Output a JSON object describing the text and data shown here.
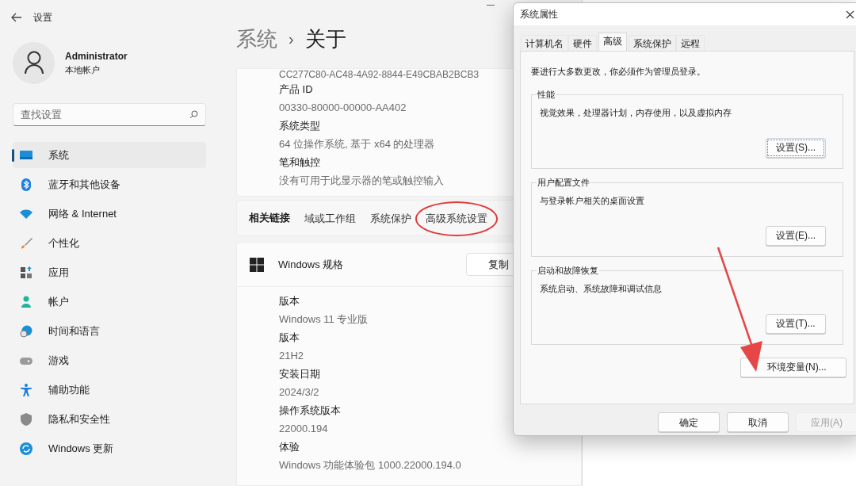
{
  "settings": {
    "title": "设置",
    "user": {
      "name": "Administrator",
      "type": "本地帐户"
    },
    "search": {
      "placeholder": "查找设置"
    },
    "nav": [
      {
        "kind": "system",
        "label": "系统",
        "selected": true
      },
      {
        "kind": "bluetooth",
        "label": "蓝牙和其他设备",
        "selected": false
      },
      {
        "kind": "network",
        "label": "网络 & Internet",
        "selected": false
      },
      {
        "kind": "personalize",
        "label": "个性化",
        "selected": false
      },
      {
        "kind": "apps",
        "label": "应用",
        "selected": false
      },
      {
        "kind": "account",
        "label": "帐户",
        "selected": false
      },
      {
        "kind": "time",
        "label": "时间和语言",
        "selected": false
      },
      {
        "kind": "gaming",
        "label": "游戏",
        "selected": false
      },
      {
        "kind": "accessibility",
        "label": "辅助功能",
        "selected": false
      },
      {
        "kind": "privacy",
        "label": "隐私和安全性",
        "selected": false
      },
      {
        "kind": "update",
        "label": "Windows 更新",
        "selected": false
      }
    ],
    "breadcrumb": {
      "parent": "系统",
      "separator": "›",
      "current": "关于"
    },
    "device_spec": {
      "cut_value": "CC277C80-AC48-4A92-8844-E49CBAB2BCB3",
      "fields": [
        {
          "label": "产品 ID",
          "value": "00330-80000-00000-AA402"
        },
        {
          "label": "系统类型",
          "value": "64 位操作系统, 基于 x64 的处理器"
        },
        {
          "label": "笔和触控",
          "value": "没有可用于此显示器的笔或触控输入"
        }
      ]
    },
    "related_links": {
      "label": "相关链接",
      "links": [
        {
          "text": "域或工作组",
          "circled": false
        },
        {
          "text": "系统保护",
          "circled": false
        },
        {
          "text": "高级系统设置",
          "circled": true
        }
      ]
    },
    "windows_spec": {
      "title": "Windows 规格",
      "copy_button": "复制",
      "fields": [
        {
          "label": "版本",
          "value": "Windows 11 专业版"
        },
        {
          "label": "版本",
          "value": "21H2"
        },
        {
          "label": "安装日期",
          "value": "2024/3/2"
        },
        {
          "label": "操作系统版本",
          "value": "22000.194"
        },
        {
          "label": "体验",
          "value": "Windows 功能体验包 1000.22000.194.0"
        }
      ]
    }
  },
  "dialog": {
    "title": "系统属性",
    "tabs": [
      {
        "label": "计算机名",
        "selected": false
      },
      {
        "label": "硬件",
        "selected": false
      },
      {
        "label": "高级",
        "selected": true
      },
      {
        "label": "系统保护",
        "selected": false
      },
      {
        "label": "远程",
        "selected": false
      }
    ],
    "notice": "要进行大多数更改，你必须作为管理员登录。",
    "groups": [
      {
        "title": "性能",
        "description": "视觉效果，处理器计划，内存使用，以及虚拟内存",
        "button": "设置(S)...",
        "focused": true
      },
      {
        "title": "用户配置文件",
        "description": "与登录帐户相关的桌面设置",
        "button": "设置(E)...",
        "focused": false
      },
      {
        "title": "启动和故障恢复",
        "description": "系统启动、系统故障和调试信息",
        "button": "设置(T)...",
        "focused": false
      }
    ],
    "env_button": {
      "label": "环境变量(N)...",
      "arrow": true
    },
    "buttons": [
      {
        "label": "确定",
        "disabled": false
      },
      {
        "label": "取消",
        "disabled": false
      },
      {
        "label": "应用(A)",
        "disabled": true
      }
    ]
  }
}
